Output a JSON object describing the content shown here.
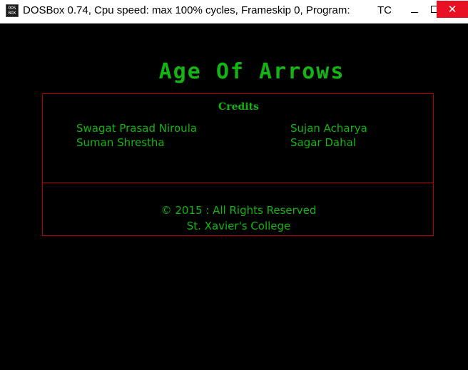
{
  "window": {
    "title": "DOSBox 0.74, Cpu speed: max 100% cycles, Frameskip  0, Program:",
    "program": "TC",
    "icon_label": "DOS BOX",
    "controls": {
      "minimize": "minimize-icon",
      "maximize": "maximize-icon",
      "close": "✕"
    }
  },
  "screen": {
    "title": "Age Of Arrows",
    "credits": {
      "heading": "Credits",
      "names": [
        "Swagat Prasad Niroula",
        "Sujan Acharya",
        "Suman Shrestha",
        "Sagar Dahal"
      ]
    },
    "copyright": {
      "line1": "© 2015 : All Rights Reserved",
      "line2": "St. Xavier's College"
    }
  },
  "colors": {
    "text_green": "#14b414",
    "border_red": "#b40000",
    "background": "#000000",
    "close_button": "#e81123"
  }
}
